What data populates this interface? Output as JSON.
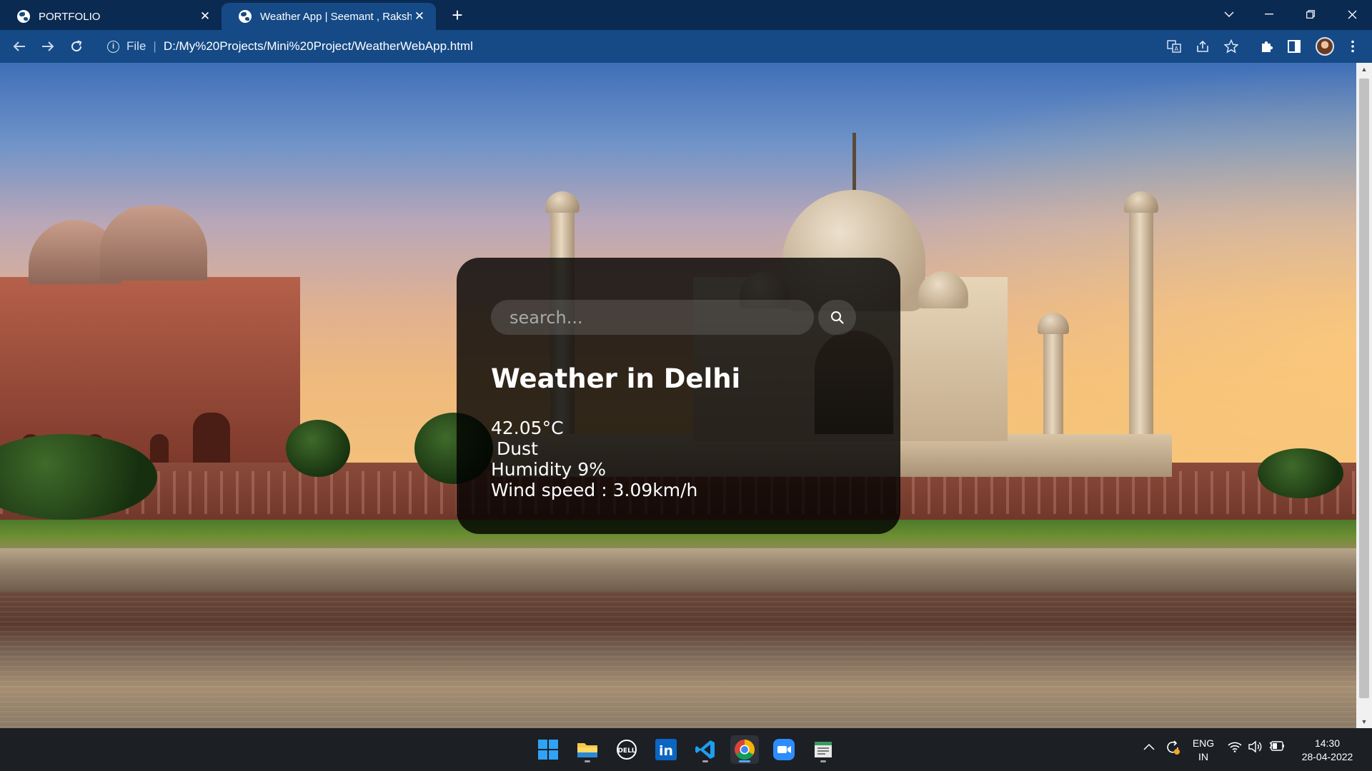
{
  "browser": {
    "tabs": [
      {
        "title": "PORTFOLIO",
        "active": false
      },
      {
        "title": "Weather App | Seemant , Rakshan",
        "active": true
      }
    ],
    "address": {
      "scheme_label": "File",
      "url": "D:/My%20Projects/Mini%20Project/WeatherWebApp.html"
    },
    "icons": [
      "globe-icon",
      "close-icon",
      "plus-icon",
      "chevron-down-icon",
      "minimize-icon",
      "restore-icon",
      "window-close-icon",
      "back-arrow-icon",
      "forward-arrow-icon",
      "reload-icon",
      "info-icon",
      "translate-icon",
      "share-icon",
      "star-icon",
      "puzzle-icon",
      "sidebar-icon",
      "avatar",
      "kebab-menu-icon"
    ]
  },
  "weather_card": {
    "search_placeholder": "search...",
    "title": "Weather in Delhi",
    "temperature": "42.05°C",
    "description": " Dust",
    "humidity": "Humidity 9%",
    "wind": "Wind speed : 3.09km/h"
  },
  "taskbar": {
    "apps": [
      "windows-start",
      "file-explorer",
      "dell",
      "linkedin",
      "vscode",
      "chrome",
      "zoom",
      "notepad"
    ],
    "active_app": "chrome",
    "tray": {
      "lang_top": "ENG",
      "lang_bottom": "IN",
      "time": "14:30",
      "date": "28-04-2022"
    }
  },
  "colors": {
    "titlebar": "#0b2a52",
    "toolbar": "#154a86",
    "card_bg": "rgba(0,0,0,0.8)",
    "taskbar": "#1c1f24"
  }
}
